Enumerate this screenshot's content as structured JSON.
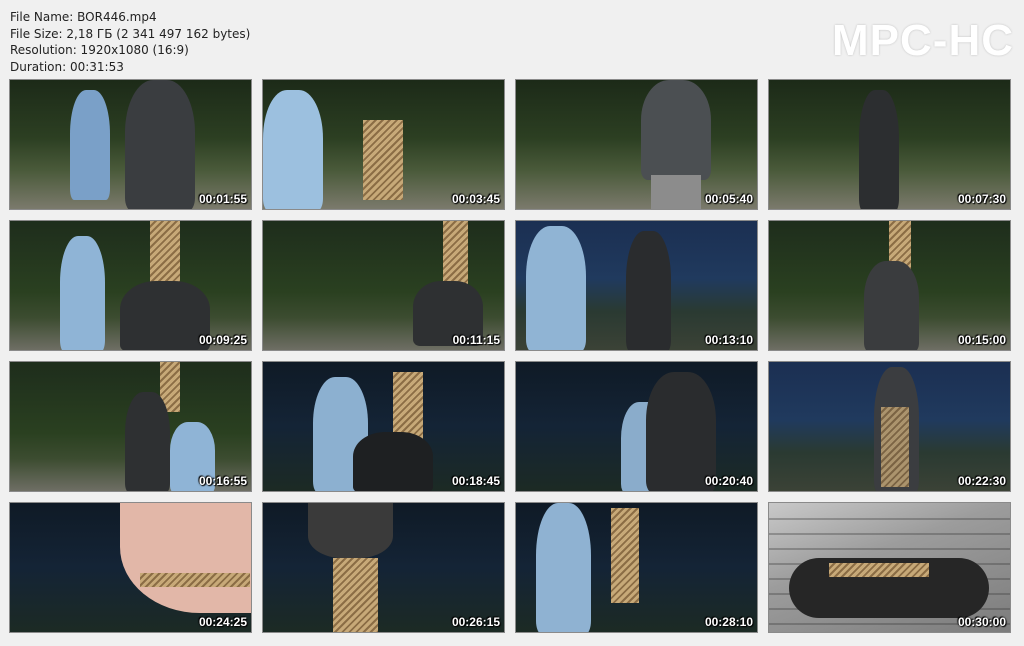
{
  "file_info": {
    "file_name": "File Name: BOR446.mp4",
    "file_size": "File Size: 2,18 ГБ (2 341 497 162 bytes)",
    "resolution": "Resolution: 1920x1080 (16:9)",
    "duration": "Duration: 00:31:53"
  },
  "logo": "MPC-HC",
  "thumbnails": [
    {
      "timestamp": "00:01:55",
      "scene": "forest"
    },
    {
      "timestamp": "00:03:45",
      "scene": "forest"
    },
    {
      "timestamp": "00:05:40",
      "scene": "forest"
    },
    {
      "timestamp": "00:07:30",
      "scene": "forest"
    },
    {
      "timestamp": "00:09:25",
      "scene": "forest2"
    },
    {
      "timestamp": "00:11:15",
      "scene": "forest2"
    },
    {
      "timestamp": "00:13:10",
      "scene": "dusk"
    },
    {
      "timestamp": "00:15:00",
      "scene": "forest2"
    },
    {
      "timestamp": "00:16:55",
      "scene": "forest2"
    },
    {
      "timestamp": "00:18:45",
      "scene": "night"
    },
    {
      "timestamp": "00:20:40",
      "scene": "night"
    },
    {
      "timestamp": "00:22:30",
      "scene": "dusk"
    },
    {
      "timestamp": "00:24:25",
      "scene": "night"
    },
    {
      "timestamp": "00:26:15",
      "scene": "night"
    },
    {
      "timestamp": "00:28:10",
      "scene": "night"
    },
    {
      "timestamp": "00:30:00",
      "scene": "deck"
    }
  ]
}
